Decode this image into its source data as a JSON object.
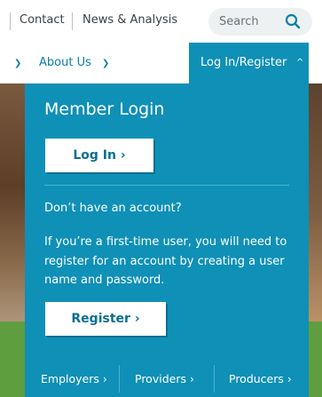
{
  "utility_nav": {
    "contact": "Contact",
    "news": "News & Analysis",
    "search_placeholder": "Search"
  },
  "main_nav": {
    "about": "About Us",
    "login_tab": "Log In/Register"
  },
  "login_panel": {
    "title": "Member Login",
    "login_button": "Log In",
    "question": "Don’t have an account?",
    "description": "If you’re a first-time user, you will need to register for an account by creating a user name and password.",
    "register_button": "Register"
  },
  "footer_links": {
    "employers": "Employers",
    "providers": "Providers",
    "producers": "Producers"
  },
  "colors": {
    "accent": "#0f90b6",
    "link": "#0a7fa6"
  }
}
